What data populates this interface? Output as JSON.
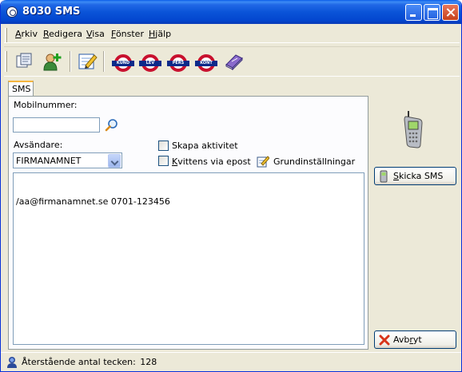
{
  "window": {
    "title": "8030 SMS"
  },
  "menu": [
    {
      "pre": "",
      "u": "A",
      "post": "rkiv"
    },
    {
      "pre": "",
      "u": "R",
      "post": "edigera"
    },
    {
      "pre": "",
      "u": "V",
      "post": "isa"
    },
    {
      "pre": "",
      "u": "F",
      "post": "önster"
    },
    {
      "pre": "",
      "u": "H",
      "post": "jälp"
    }
  ],
  "toolbar": {
    "roundels": [
      "KUND",
      "LEV",
      "PERS",
      "KONT"
    ]
  },
  "tab": {
    "label": "SMS"
  },
  "form": {
    "mobile_label": "Mobilnummer:",
    "mobile_value": "",
    "sender_label": "Avsändare:",
    "sender_value": "FIRMANAMNET",
    "create_activity_label": "Skapa aktivitet",
    "create_activity_checked": false,
    "receipt_pre": "",
    "receipt_u": "K",
    "receipt_post": "vittens via epost",
    "receipt_checked": false,
    "settings_label": "Grundinställningar",
    "message": "/aa@firmanamnet.se 0701-123456"
  },
  "buttons": {
    "send_pre": "",
    "send_u": "S",
    "send_post": "kicka SMS",
    "cancel_pre": "Avb",
    "cancel_u": "r",
    "cancel_post": "yt"
  },
  "status": {
    "remaining_label": "Återstående antal tecken:",
    "remaining_count": "128"
  },
  "colors": {
    "titlebar": "#0a54d8",
    "window_bg": "#ece9d8",
    "roundel_red": "#c8102e",
    "roundel_blue": "#0b2a8a"
  }
}
